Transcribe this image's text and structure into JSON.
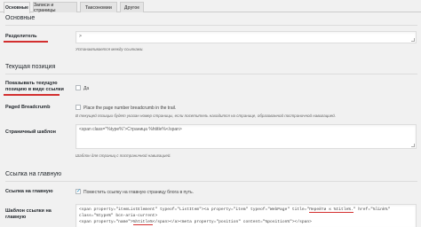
{
  "tabs": [
    {
      "label": "Основные"
    },
    {
      "label": "Записи и страницы"
    },
    {
      "label": "Таксономии"
    },
    {
      "label": "Другое"
    }
  ],
  "sections": {
    "basic": "Основные",
    "current_position": "Текущая позиция",
    "home_link": "Ссылка на главную"
  },
  "separator": {
    "label": "Разделитель",
    "value": "&gt;",
    "description": "Устанавливается между ссылками."
  },
  "show_current": {
    "label": "Показывать текущую позицию в виде ссылки",
    "checkbox_label": "Да",
    "checked": false
  },
  "paged_breadcrumb": {
    "label": "Paged Breadcrumb",
    "checkbox_label": "Place the page number breadcrumb in the trail.",
    "description": "В текущей позиции будет указан номер страницы, если посетитель находится на странице, образованной постраничной навигацией.",
    "checked": false
  },
  "page_template": {
    "label": "Страничный шаблон",
    "value": "<span class=\"%type%\">Страница %htitle%</span>",
    "description": "Шаблон для страниц с постраничной навигацией."
  },
  "home_link_setting": {
    "label": "Ссылка на главную",
    "checkbox_label": "Поместить ссылку на главную страницу блога в путь.",
    "checked": true
  },
  "home_template": {
    "label": "Шаблон ссылки на главную",
    "line1_a": "<span property=\"itemListElement\" typeof=\"ListItem\"><a property=\"item\" typeof=\"WebPage\" title=\"",
    "line1_ul": "Перейти к %title%.",
    "line1_b": "\" href=\"%link%\" class=\"%type%\" bcn-aria-current>",
    "line2_a": "<span property=\"name\">",
    "line2_ul": "%htitle%",
    "line2_b": "</span></a><meta property=\"position\" content=\"%position%\"></span>"
  },
  "colors": {
    "highlight": "#d32f2f",
    "checkmark": "#1e8cbe"
  }
}
